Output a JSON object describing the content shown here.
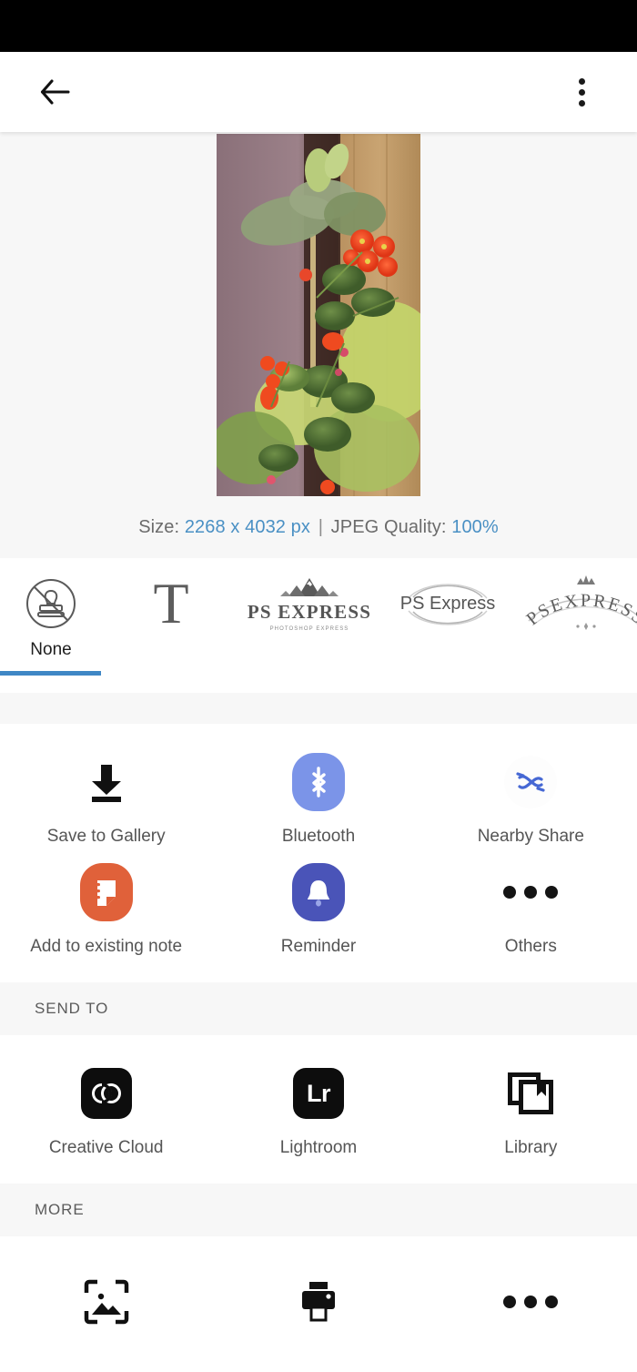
{
  "status_bar": {
    "background": "#000000"
  },
  "app_bar": {
    "back_icon": "arrow-left-icon",
    "overflow_icon": "more-vertical-icon"
  },
  "preview": {
    "photo_alt": "Potted crown-of-thorns plant with red flowers against a brown curtain and wood wall",
    "meta": {
      "size_label": "Size:",
      "size_value": "2268 x 4032 px",
      "separator": "|",
      "quality_label": "JPEG Quality:",
      "quality_value": "100%"
    }
  },
  "watermarks": {
    "selected_index": 0,
    "accent_color": "#3f87c5",
    "items": [
      {
        "label": "None",
        "icon": "no-stamp-icon",
        "type": "none"
      },
      {
        "label": "",
        "icon": "serif-t-icon",
        "type": "letter",
        "glyph": "T"
      },
      {
        "label": "",
        "icon": "mountain-logo-icon",
        "type": "mountain",
        "name": "PS EXPRESS",
        "sub": "PHOTOSHOP EXPRESS"
      },
      {
        "label": "",
        "icon": "oval-badge-logo-icon",
        "type": "badge",
        "name": "PS Express"
      },
      {
        "label": "",
        "icon": "crown-arc-logo-icon",
        "type": "arc",
        "name": "PSEXPRESS"
      }
    ]
  },
  "share": {
    "rows": [
      [
        {
          "label": "Save to Gallery",
          "icon": "download-icon",
          "style": "glyph-black"
        },
        {
          "label": "Bluetooth",
          "icon": "bluetooth-icon",
          "style": "squircle",
          "color": "#7b94e8"
        },
        {
          "label": "Nearby Share",
          "icon": "nearby-share-icon",
          "style": "circle-white",
          "color": "#4668d4"
        }
      ],
      [
        {
          "label": "Add to existing note",
          "icon": "samsung-notes-icon",
          "style": "squircle",
          "color": "#e0613a"
        },
        {
          "label": "Reminder",
          "icon": "reminder-bell-icon",
          "style": "squircle",
          "color": "#4a54b8"
        },
        {
          "label": "Others",
          "icon": "more-horizontal-icon",
          "style": "glyph-black"
        }
      ]
    ]
  },
  "send_to": {
    "header": "SEND TO",
    "items": [
      {
        "label": "Creative Cloud",
        "icon": "creative-cloud-icon"
      },
      {
        "label": "Lightroom",
        "icon": "lightroom-icon",
        "glyph": "Lr"
      },
      {
        "label": "Library",
        "icon": "library-icon"
      }
    ]
  },
  "more": {
    "header": "MORE",
    "items": [
      {
        "label": "",
        "icon": "set-as-wallpaper-icon"
      },
      {
        "label": "",
        "icon": "printer-icon"
      },
      {
        "label": "",
        "icon": "more-horizontal-icon"
      }
    ]
  }
}
